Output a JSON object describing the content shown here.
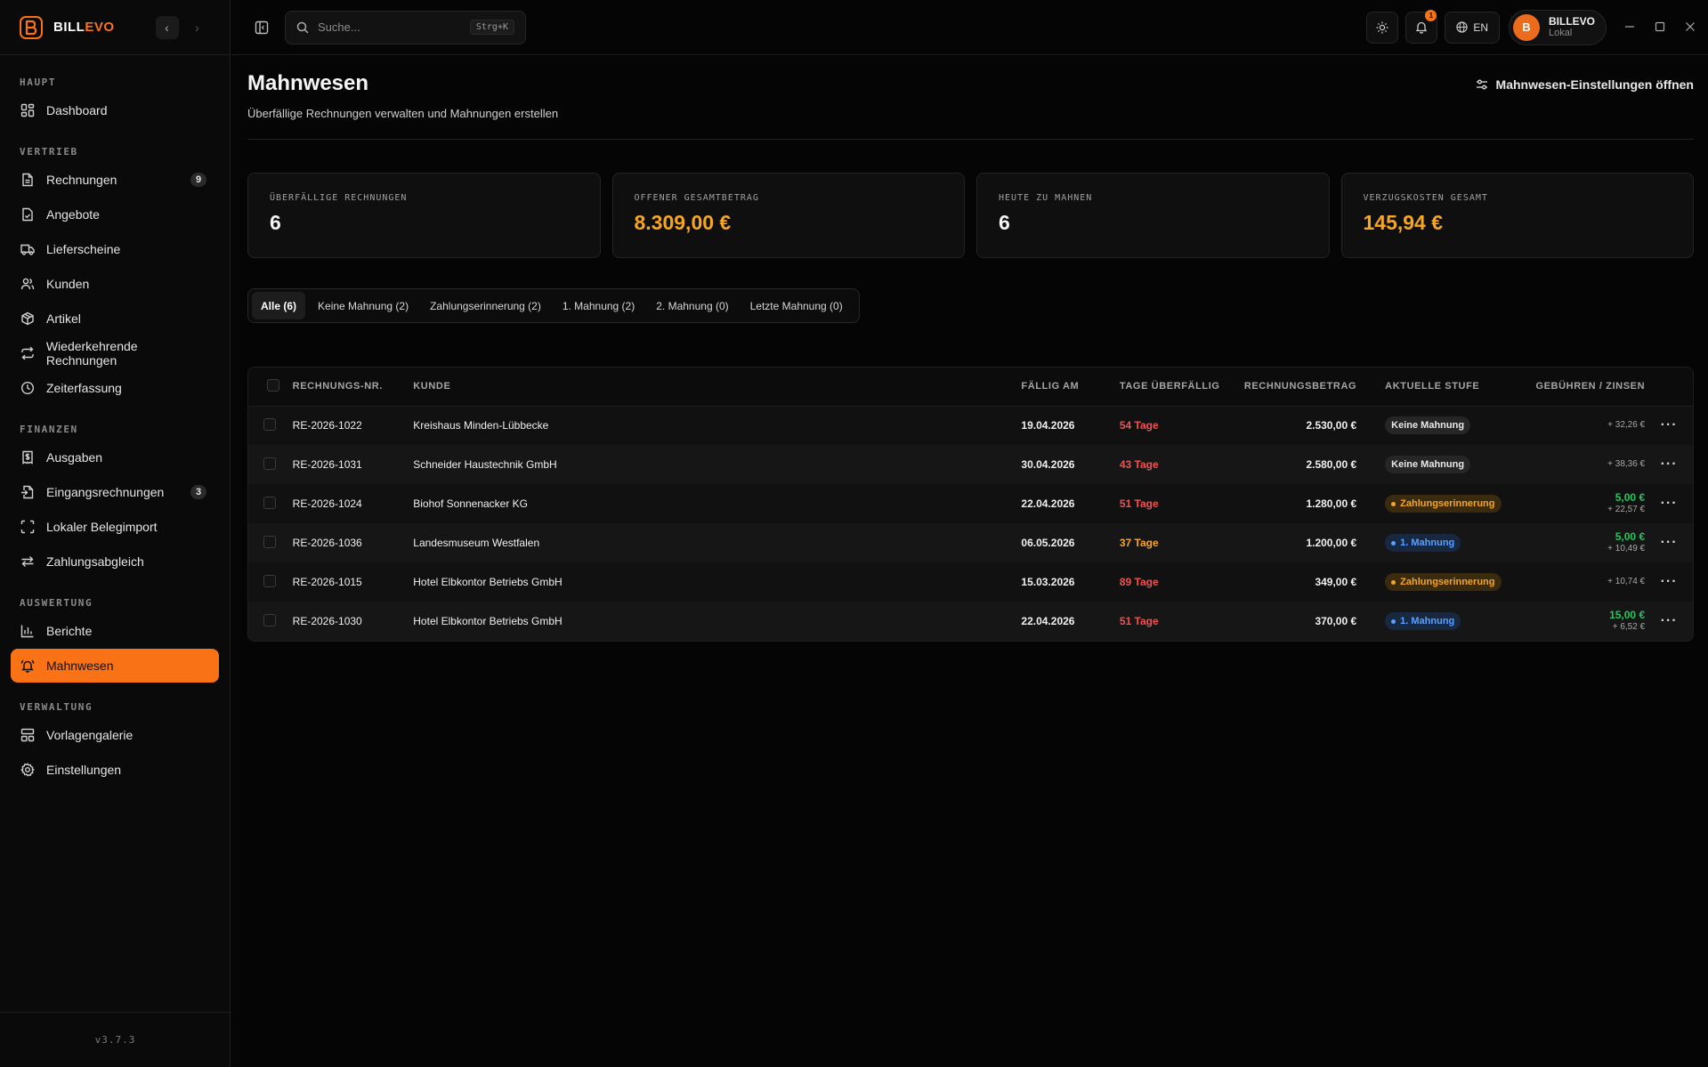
{
  "brand": {
    "part1": "BILL",
    "part2": "EVO",
    "accent": "#f97316"
  },
  "sidebar": {
    "sections": [
      {
        "title": "HAUPT",
        "items": [
          {
            "label": "Dashboard",
            "icon": "dashboard-icon"
          }
        ]
      },
      {
        "title": "VERTRIEB",
        "items": [
          {
            "label": "Rechnungen",
            "icon": "file-text-icon",
            "badge": "9"
          },
          {
            "label": "Angebote",
            "icon": "file-check-icon"
          },
          {
            "label": "Lieferscheine",
            "icon": "truck-icon"
          },
          {
            "label": "Kunden",
            "icon": "users-icon"
          },
          {
            "label": "Artikel",
            "icon": "package-icon"
          },
          {
            "label": "Wiederkehrende Rechnungen",
            "icon": "repeat-icon"
          },
          {
            "label": "Zeiterfassung",
            "icon": "clock-icon"
          }
        ]
      },
      {
        "title": "FINANZEN",
        "items": [
          {
            "label": "Ausgaben",
            "icon": "receipt-icon"
          },
          {
            "label": "Eingangsrechnungen",
            "icon": "file-import-icon",
            "badge": "3"
          },
          {
            "label": "Lokaler Belegimport",
            "icon": "scan-icon"
          },
          {
            "label": "Zahlungsabgleich",
            "icon": "arrows-icon"
          }
        ]
      },
      {
        "title": "AUSWERTUNG",
        "items": [
          {
            "label": "Berichte",
            "icon": "bar-chart-icon"
          },
          {
            "label": "Mahnwesen",
            "icon": "bell-ring-icon",
            "active": true
          }
        ]
      },
      {
        "title": "VERWALTUNG",
        "items": [
          {
            "label": "Vorlagengalerie",
            "icon": "layout-icon"
          },
          {
            "label": "Einstellungen",
            "icon": "settings-icon"
          }
        ]
      }
    ],
    "version": "v3.7.3"
  },
  "topbar": {
    "search_placeholder": "Suche...",
    "search_shortcut": "Strg+K",
    "notification_count": "1",
    "language": "EN",
    "user": {
      "initial": "B",
      "name": "BILLEVO",
      "sub": "Lokal"
    }
  },
  "page": {
    "title": "Mahnwesen",
    "subtitle": "Überfällige Rechnungen verwalten und Mahnungen erstellen",
    "settings_link": "Mahnwesen-Einstellungen öffnen"
  },
  "stats": [
    {
      "label": "ÜBERFÄLLIGE RECHNUNGEN",
      "value": "6"
    },
    {
      "label": "OFFENER GESAMTBETRAG",
      "value": "8.309,00 €"
    },
    {
      "label": "HEUTE ZU MAHNEN",
      "value": "6"
    },
    {
      "label": "VERZUGSKOSTEN GESAMT",
      "value": "145,94 €"
    }
  ],
  "tabs": [
    "Alle (6)",
    "Keine Mahnung (2)",
    "Zahlungserinnerung (2)",
    "1. Mahnung (2)",
    "2. Mahnung (0)",
    "Letzte Mahnung (0)"
  ],
  "table": {
    "headers": [
      "RECHNUNGS-NR.",
      "KUNDE",
      "FÄLLIG AM",
      "TAGE ÜBERFÄLLIG",
      "RECHNUNGSBETRAG",
      "AKTUELLE STUFE",
      "GEBÜHREN / ZINSEN"
    ],
    "rows": [
      {
        "nr": "RE-2026-1022",
        "kunde": "Kreishaus Minden-Lübbecke",
        "faellig": "19.04.2026",
        "tage": "54 Tage",
        "betrag": "2.530,00 €",
        "stufe": "Keine Mahnung",
        "fee": "",
        "zins": "+ 32,26 €"
      },
      {
        "nr": "RE-2026-1031",
        "kunde": "Schneider Haustechnik GmbH",
        "faellig": "30.04.2026",
        "tage": "43 Tage",
        "betrag": "2.580,00 €",
        "stufe": "Keine Mahnung",
        "fee": "",
        "zins": "+ 38,36 €"
      },
      {
        "nr": "RE-2026-1024",
        "kunde": "Biohof Sonnenacker KG",
        "faellig": "22.04.2026",
        "tage": "51 Tage",
        "betrag": "1.280,00 €",
        "stufe": "Zahlungserinnerung",
        "fee": "5,00 €",
        "zins": "+ 22,57 €"
      },
      {
        "nr": "RE-2026-1036",
        "kunde": "Landesmuseum Westfalen",
        "faellig": "06.05.2026",
        "tage": "37 Tage",
        "betrag": "1.200,00 €",
        "stufe": "1. Mahnung",
        "fee": "5,00 €",
        "zins": "+ 10,49 €"
      },
      {
        "nr": "RE-2026-1015",
        "kunde": "Hotel Elbkontor Betriebs GmbH",
        "faellig": "15.03.2026",
        "tage": "89 Tage",
        "betrag": "349,00 €",
        "stufe": "Zahlungserinnerung",
        "fee": "",
        "zins": "+ 10,74 €"
      },
      {
        "nr": "RE-2026-1030",
        "kunde": "Hotel Elbkontor Betriebs GmbH",
        "faellig": "22.04.2026",
        "tage": "51 Tage",
        "betrag": "370,00 €",
        "stufe": "1. Mahnung",
        "fee": "15,00 €",
        "zins": "+ 6,52 €"
      }
    ]
  }
}
